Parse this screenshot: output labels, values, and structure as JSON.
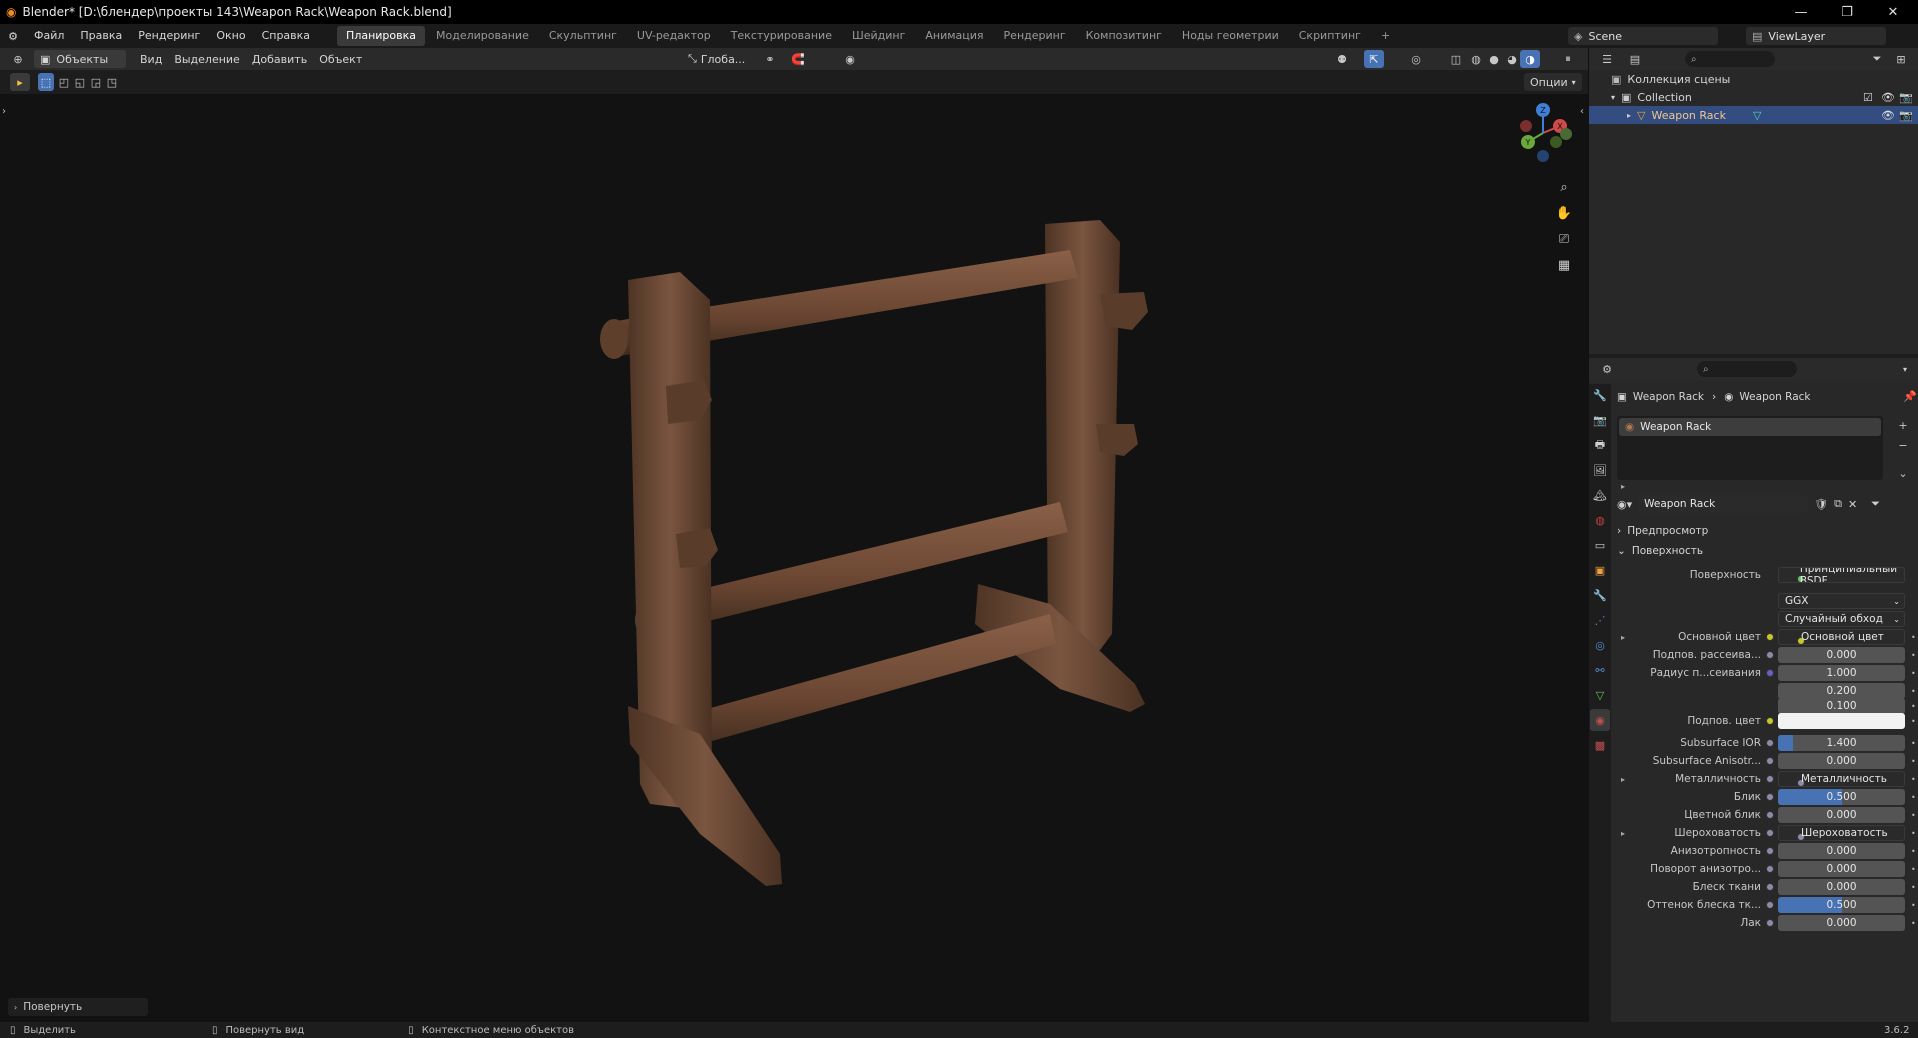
{
  "window": {
    "title": "Blender* [D:\\блендер\\проекты 143\\Weapon Rack\\Weapon Rack.blend]",
    "minimize": "—",
    "maximize": "❐",
    "close": "✕"
  },
  "menu": {
    "items": [
      "Файл",
      "Правка",
      "Рендеринг",
      "Окно",
      "Справка"
    ],
    "workspaces": [
      "Планировка",
      "Моделирование",
      "Скульптинг",
      "UV-редактор",
      "Текстурирование",
      "Шейдинг",
      "Анимация",
      "Рендеринг",
      "Композитинг",
      "Ноды геометрии",
      "Скриптинг"
    ],
    "active_workspace": "Планировка",
    "add_tab": "+",
    "scene": "Scene",
    "view_layer": "ViewLayer"
  },
  "viewport_header": {
    "mode": "Объекты",
    "menus": [
      "Вид",
      "Выделение",
      "Добавить",
      "Объект"
    ],
    "orientation": "Глоба...",
    "options": "Опции"
  },
  "gizmo": {
    "x": "X",
    "y": "Y",
    "z": "Z"
  },
  "last_operator": "Повернуть",
  "status_bar": {
    "select": "Выделить",
    "rotate_view": "Повернуть вид",
    "context_menu": "Контекстное меню объектов",
    "version": "3.6.2"
  },
  "outliner": {
    "scene_collection": "Коллекция сцены",
    "collection": "Collection",
    "object": "Weapon Rack"
  },
  "properties": {
    "breadcrumb_object": "Weapon Rack",
    "breadcrumb_material": "Weapon Rack",
    "slot": "Weapon Rack",
    "material_name": "Weapon Rack",
    "panels": {
      "preview": "Предпросмотр",
      "surface": "Поверхность"
    },
    "surface_label": "Поверхность",
    "surface_shader": "Принципиальный BSDF",
    "distribution": "GGX",
    "subsurface_method": "Случайный обход",
    "rows": [
      {
        "label": "Основной цвет",
        "value": "Основной цвет",
        "kind": "node",
        "dot": "yellow",
        "expander": true
      },
      {
        "label": "Подпов. рассеива...",
        "value": "0.000",
        "kind": "num",
        "dot": "gray",
        "fill": 0
      },
      {
        "label": "Радиус п...сеивания",
        "value": "1.000",
        "kind": "num",
        "dot": "blue",
        "fill": 0
      },
      {
        "label": "",
        "value": "0.200",
        "kind": "num",
        "dot": "none",
        "fill": 0
      },
      {
        "label": "",
        "value": "0.100",
        "kind": "num",
        "dot": "none",
        "fill": 0
      },
      {
        "label": "Подпов. цвет",
        "value": "",
        "kind": "color",
        "dot": "yellow",
        "fill": 0
      },
      {
        "label": "Subsurface IOR",
        "value": "1.400",
        "kind": "num",
        "dot": "gray",
        "fill": 0.12
      },
      {
        "label": "Subsurface Anisotr...",
        "value": "0.000",
        "kind": "num",
        "dot": "gray",
        "fill": 0
      },
      {
        "label": "Металличность",
        "value": "Металличность",
        "kind": "node",
        "dot": "gray",
        "expander": true
      },
      {
        "label": "Блик",
        "value": "0.500",
        "kind": "num",
        "dot": "gray",
        "fill": 0.5
      },
      {
        "label": "Цветной блик",
        "value": "0.000",
        "kind": "num",
        "dot": "gray",
        "fill": 0
      },
      {
        "label": "Шероховатость",
        "value": "Шероховатость",
        "kind": "node",
        "dot": "gray",
        "expander": true
      },
      {
        "label": "Анизотропность",
        "value": "0.000",
        "kind": "num",
        "dot": "gray",
        "fill": 0
      },
      {
        "label": "Поворот анизотро...",
        "value": "0.000",
        "kind": "num",
        "dot": "gray",
        "fill": 0
      },
      {
        "label": "Блеск ткани",
        "value": "0.000",
        "kind": "num",
        "dot": "gray",
        "fill": 0
      },
      {
        "label": "Оттенок блеска тк...",
        "value": "0.500",
        "kind": "num",
        "dot": "gray",
        "fill": 0.5
      },
      {
        "label": "Лак",
        "value": "0.000",
        "kind": "num",
        "dot": "gray",
        "fill": 0
      }
    ]
  },
  "colors": {
    "accent": "#4772b3",
    "selection": "#334d80",
    "wood": "#6b4a36"
  }
}
